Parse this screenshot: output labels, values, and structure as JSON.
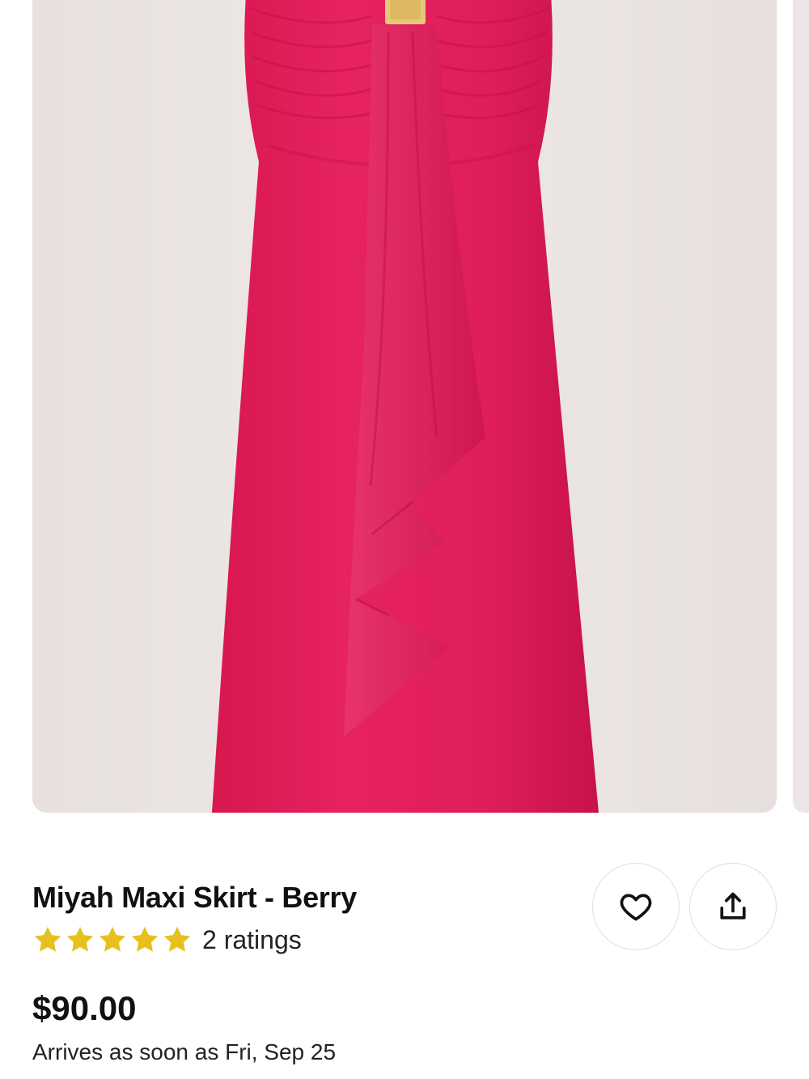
{
  "product": {
    "title": "Miyah Maxi Skirt - Berry",
    "rating": 5,
    "max_rating": 5,
    "ratings_label": "2 ratings",
    "price": "$90.00",
    "delivery": "Arrives as soon as Fri, Sep 25"
  },
  "actions": {
    "favorite_icon": "heart-icon",
    "share_icon": "share-upload-icon"
  },
  "colors": {
    "skirt": "#e01e5a",
    "star": "#e8c01e",
    "image_background": "#eae4e2"
  }
}
